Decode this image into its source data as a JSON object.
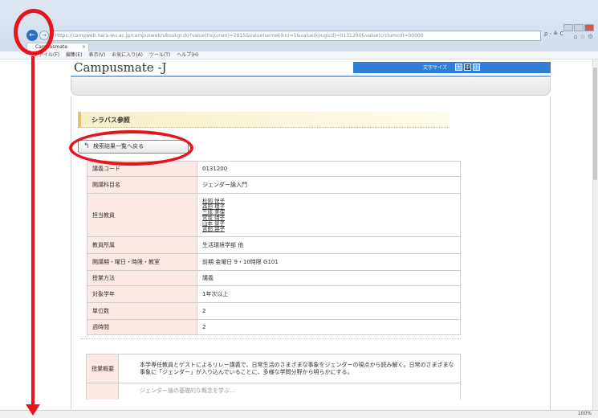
{
  "browser": {
    "address": "https://campweb.nara-wu.ac.jp/campusweb/slbsskgr.do?value(risyunen)=2015&value(semekikn)=1&value(kougicd)=0131200&value(crclumcd)=00000",
    "tab_title": "Campusmate",
    "tab_close": "×",
    "back_symbol": "←",
    "forward_symbol": "→",
    "tools_text": "ρ - ≜ C",
    "right_icons": "⌂ ☆ ⚙",
    "menus": [
      "ファイル(F)",
      "編集(E)",
      "表示(V)",
      "お気に入り(A)",
      "ツール(T)",
      "ヘルプ(H)"
    ],
    "zoom": "100%"
  },
  "site": {
    "title": "Campusmate -J",
    "font_size_label": "文字サイズ",
    "font_large": "大",
    "font_mid": "中",
    "font_small": "小"
  },
  "page": {
    "section_title": "シラバス参照",
    "back_button": "検索結果一覧へ戻る",
    "back_icon": "↰"
  },
  "info_rows": [
    {
      "label": "講義コード",
      "value": "0131200"
    },
    {
      "label": "開講科目名",
      "value": "ジェンダー論入門"
    }
  ],
  "teachers": {
    "label": "担当教員",
    "names": [
      "松岡 悦子",
      "森田 理子",
      "三成 美保",
      "宮坂 靖子",
      "山本 景子",
      "吉田 容子"
    ]
  },
  "info_rows2": [
    {
      "label": "教員所属",
      "value": "生活環境学部 他"
    },
    {
      "label": "開講期・曜日・時限・教室",
      "value": "前期 金曜日 9・10時限 G101"
    },
    {
      "label": "授業方法",
      "value": "講義"
    },
    {
      "label": "対象学年",
      "value": "1年次以上"
    },
    {
      "label": "単位数",
      "value": "2"
    },
    {
      "label": "週時間",
      "value": "2"
    }
  ],
  "overview": {
    "label": "授業概要",
    "text": "本学専任教員とゲストによるリレー講義で、日常生活のさまざまな事象をジェンダーの視点から読み解く。日常のさまざまな事象に「ジェンダー」が入り込んでいることに、多様な学問分野から明らかにする。",
    "next_text": "ジェンダー論の基礎的な概念を学ぶ…"
  },
  "colors": {
    "annotation": "#e8141c",
    "header_blue": "#2f7fd6",
    "label_bg": "#fbe9e3"
  }
}
